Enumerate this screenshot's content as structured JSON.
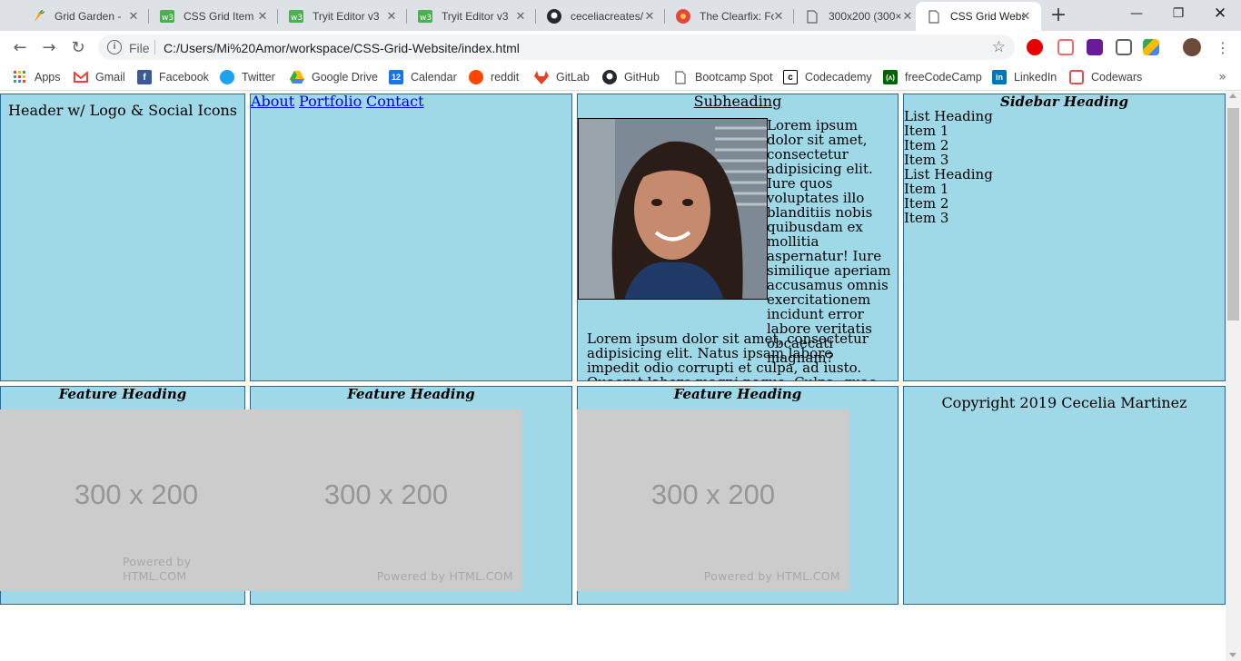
{
  "tabs": [
    {
      "title": "Grid Garden -",
      "icon": "carrot-icon",
      "active": false
    },
    {
      "title": "CSS Grid Item",
      "icon": "w3schools-icon",
      "active": false
    },
    {
      "title": "Tryit Editor v3",
      "icon": "w3schools-icon",
      "active": false
    },
    {
      "title": "Tryit Editor v3",
      "icon": "w3schools-icon",
      "active": false
    },
    {
      "title": "ceceliacreates/",
      "icon": "github-icon",
      "active": false
    },
    {
      "title": "The Clearfix: Fo",
      "icon": "clearfix-icon",
      "active": false
    },
    {
      "title": "300x200 (300×",
      "icon": "page-icon",
      "active": false
    },
    {
      "title": "CSS Grid Webs",
      "icon": "page-icon",
      "active": true
    }
  ],
  "toolbar": {
    "file_label": "File",
    "url": "C:/Users/Mi%20Amor/workspace/CSS-Grid-Website/index.html"
  },
  "bookmarks": [
    {
      "label": "Apps",
      "icon": "apps-grid-icon"
    },
    {
      "label": "Gmail",
      "icon": "gmail-icon"
    },
    {
      "label": "Facebook",
      "icon": "facebook-icon"
    },
    {
      "label": "Twitter",
      "icon": "twitter-icon"
    },
    {
      "label": "Google Drive",
      "icon": "google-drive-icon"
    },
    {
      "label": "Calendar",
      "icon": "calendar-icon"
    },
    {
      "label": "reddit",
      "icon": "reddit-icon"
    },
    {
      "label": "GitLab",
      "icon": "gitlab-icon"
    },
    {
      "label": "GitHub",
      "icon": "github-icon"
    },
    {
      "label": "Bootcamp Spot",
      "icon": "page-icon"
    },
    {
      "label": "Codecademy",
      "icon": "codecademy-icon"
    },
    {
      "label": "freeCodeCamp",
      "icon": "freecodecamp-icon"
    },
    {
      "label": "LinkedIn",
      "icon": "linkedin-icon"
    },
    {
      "label": "Codewars",
      "icon": "codewars-icon"
    }
  ],
  "page": {
    "header_text": "Header w/ Logo & Social Icons",
    "nav": [
      "About",
      "Portfolio",
      "Contact"
    ],
    "subheading": "Subheading",
    "main_para1": "Lorem ipsum dolor sit amet, consectetur adipisicing elit. Iure quos voluptates illo blanditiis nobis quibusdam ex mollitia aspernatur! Iure similique aperiam accusamus omnis exercitationem incidunt error labore veritatis obcaecati magnam?",
    "main_para2": "Lorem ipsum dolor sit amet, consectetur adipisicing elit. Natus ipsam labore impedit odio corrupti et culpa, ad iusto. Quaerat labore magni neque. Culpa, quae animi assumenda illum",
    "sidebar_heading": "Sidebar Heading",
    "sidebar_lists": [
      {
        "heading": "List Heading",
        "items": [
          "Item 1",
          "Item 2",
          "Item 3"
        ]
      },
      {
        "heading": "List Heading",
        "items": [
          "Item 1",
          "Item 2",
          "Item 3"
        ]
      }
    ],
    "feature_heading": "Feature Heading",
    "placeholder_text": "300 x 200",
    "placeholder_credit": "Powered by HTML.COM",
    "footer_text": "Copyright 2019 Cecelia Martinez"
  },
  "colors": {
    "cell_bg": "#9fd8e6",
    "cell_border": "#1a6fa8",
    "link": "#0000ee",
    "placeholder_bg": "#cccccc"
  }
}
